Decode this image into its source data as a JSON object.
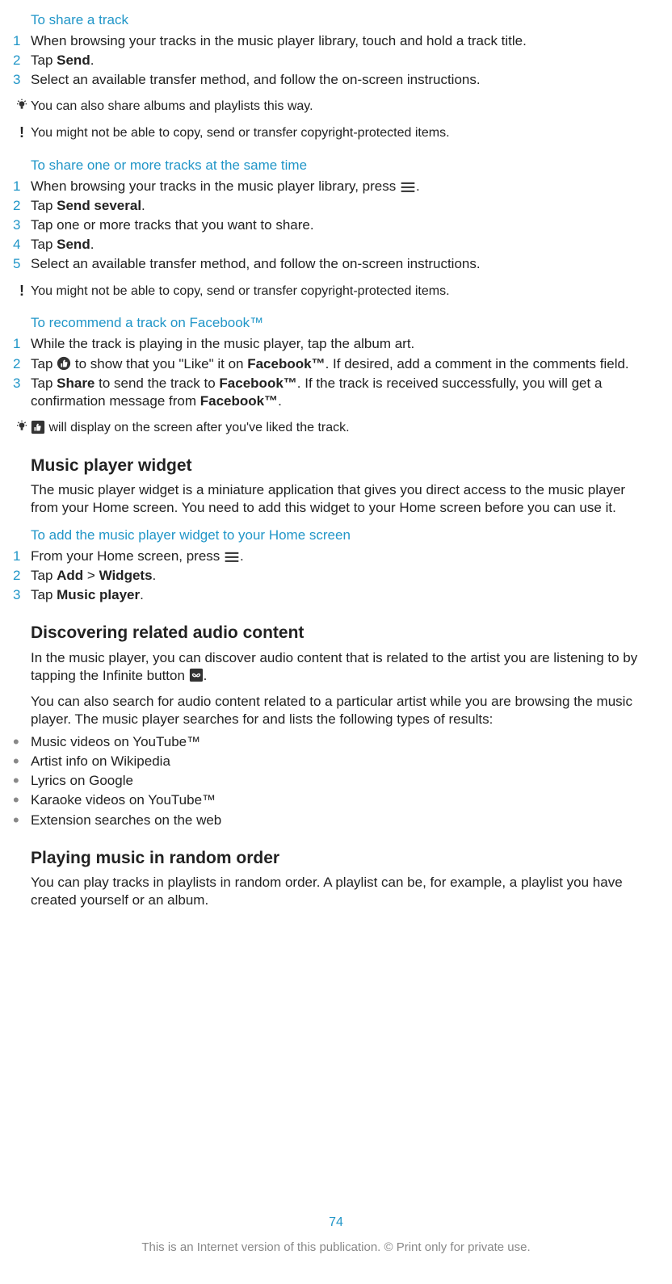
{
  "sections": {
    "share_track": {
      "title": "To share a track",
      "steps": {
        "n1": "1",
        "s1": "When browsing your tracks in the music player library, touch and hold a track title.",
        "n2": "2",
        "s2_pre": "Tap ",
        "s2_b": "Send",
        "s2_post": ".",
        "n3": "3",
        "s3": "Select an available transfer method, and follow the on-screen instructions."
      },
      "tip": "You can also share albums and playlists this way.",
      "warn": "You might not be able to copy, send or transfer copyright-protected items."
    },
    "share_multi": {
      "title": "To share one or more tracks at the same time",
      "steps": {
        "n1": "1",
        "s1_pre": "When browsing your tracks in the music player library, press ",
        "s1_post": ".",
        "n2": "2",
        "s2_pre": "Tap ",
        "s2_b": "Send several",
        "s2_post": ".",
        "n3": "3",
        "s3": "Tap one or more tracks that you want to share.",
        "n4": "4",
        "s4_pre": "Tap ",
        "s4_b": "Send",
        "s4_post": ".",
        "n5": "5",
        "s5": "Select an available transfer method, and follow the on-screen instructions."
      },
      "warn": "You might not be able to copy, send or transfer copyright-protected items."
    },
    "recommend_fb": {
      "title": "To recommend a track on Facebook™",
      "steps": {
        "n1": "1",
        "s1": "While the track is playing in the music player, tap the album art.",
        "n2": "2",
        "s2_pre": "Tap ",
        "s2_mid": " to show that you \"Like\" it on ",
        "s2_b2": "Facebook™",
        "s2_post": ". If desired, add a comment in the comments field.",
        "n3": "3",
        "s3_pre": "Tap ",
        "s3_b1": "Share",
        "s3_mid1": " to send the track to ",
        "s3_b2": "Facebook™",
        "s3_mid2": ". If the track is received successfully, you will get a confirmation message from ",
        "s3_b3": "Facebook™",
        "s3_post": "."
      },
      "tip_post": " will display on the screen after you've liked the track."
    },
    "widget": {
      "heading": "Music player widget",
      "para": "The music player widget is a miniature application that gives you direct access to the music player from your Home screen. You need to add this widget to your Home screen before you can use it.",
      "subtitle": "To add the music player widget to your Home screen",
      "steps": {
        "n1": "1",
        "s1_pre": "From your Home screen, press ",
        "s1_post": ".",
        "n2": "2",
        "s2_pre": "Tap ",
        "s2_b1": "Add",
        "s2_mid": " > ",
        "s2_b2": "Widgets",
        "s2_post": ".",
        "n3": "3",
        "s3_pre": "Tap ",
        "s3_b": "Music player",
        "s3_post": "."
      }
    },
    "discover": {
      "heading": "Discovering related audio content",
      "para1_pre": "In the music player, you can discover audio content that is related to the artist you are listening to by tapping the Infinite button ",
      "para1_post": ".",
      "para2": "You can also search for audio content related to a particular artist while you are browsing the music player. The music player searches for and lists the following types of results:",
      "bullets": {
        "b1": "Music videos on YouTube™",
        "b2": "Artist info on Wikipedia",
        "b3": "Lyrics on Google",
        "b4": "Karaoke videos on YouTube™",
        "b5": "Extension searches on the web"
      }
    },
    "random": {
      "heading": "Playing music in random order",
      "para": "You can play tracks in playlists in random order. A playlist can be, for example, a playlist you have created yourself or an album."
    }
  },
  "footer": {
    "page": "74",
    "text": "This is an Internet version of this publication. © Print only for private use."
  }
}
